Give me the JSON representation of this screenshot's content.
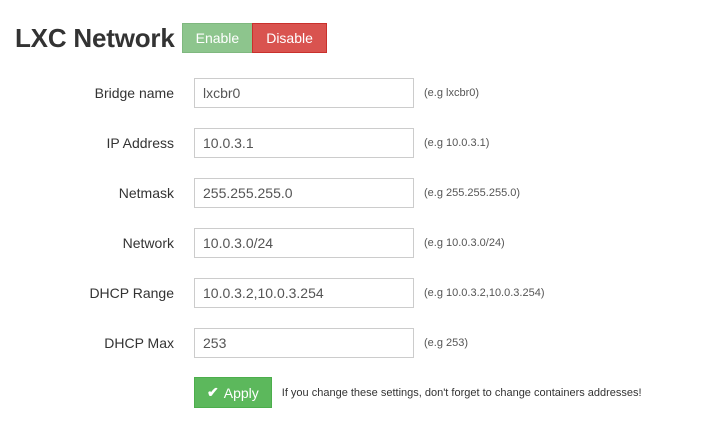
{
  "header": {
    "title": "LXC Network",
    "enable_label": "Enable",
    "disable_label": "Disable"
  },
  "form": {
    "rows": [
      {
        "label": "Bridge name",
        "value": "lxcbr0",
        "hint": "(e.g lxcbr0)"
      },
      {
        "label": "IP Address",
        "value": "10.0.3.1",
        "hint": "(e.g 10.0.3.1)"
      },
      {
        "label": "Netmask",
        "value": "255.255.255.0",
        "hint": "(e.g 255.255.255.0)"
      },
      {
        "label": "Network",
        "value": "10.0.3.0/24",
        "hint": "(e.g 10.0.3.0/24)"
      },
      {
        "label": "DHCP Range",
        "value": "10.0.3.2,10.0.3.254",
        "hint": "(e.g 10.0.3.2,10.0.3.254)"
      },
      {
        "label": "DHCP Max",
        "value": "253",
        "hint": "(e.g 253)"
      }
    ],
    "apply_label": "Apply",
    "apply_icon": "check-icon",
    "apply_note": "If you change these settings, don't forget to change containers addresses!"
  },
  "colors": {
    "enable": "#8dc58d",
    "disable": "#d9534f",
    "apply": "#5cb85c"
  }
}
